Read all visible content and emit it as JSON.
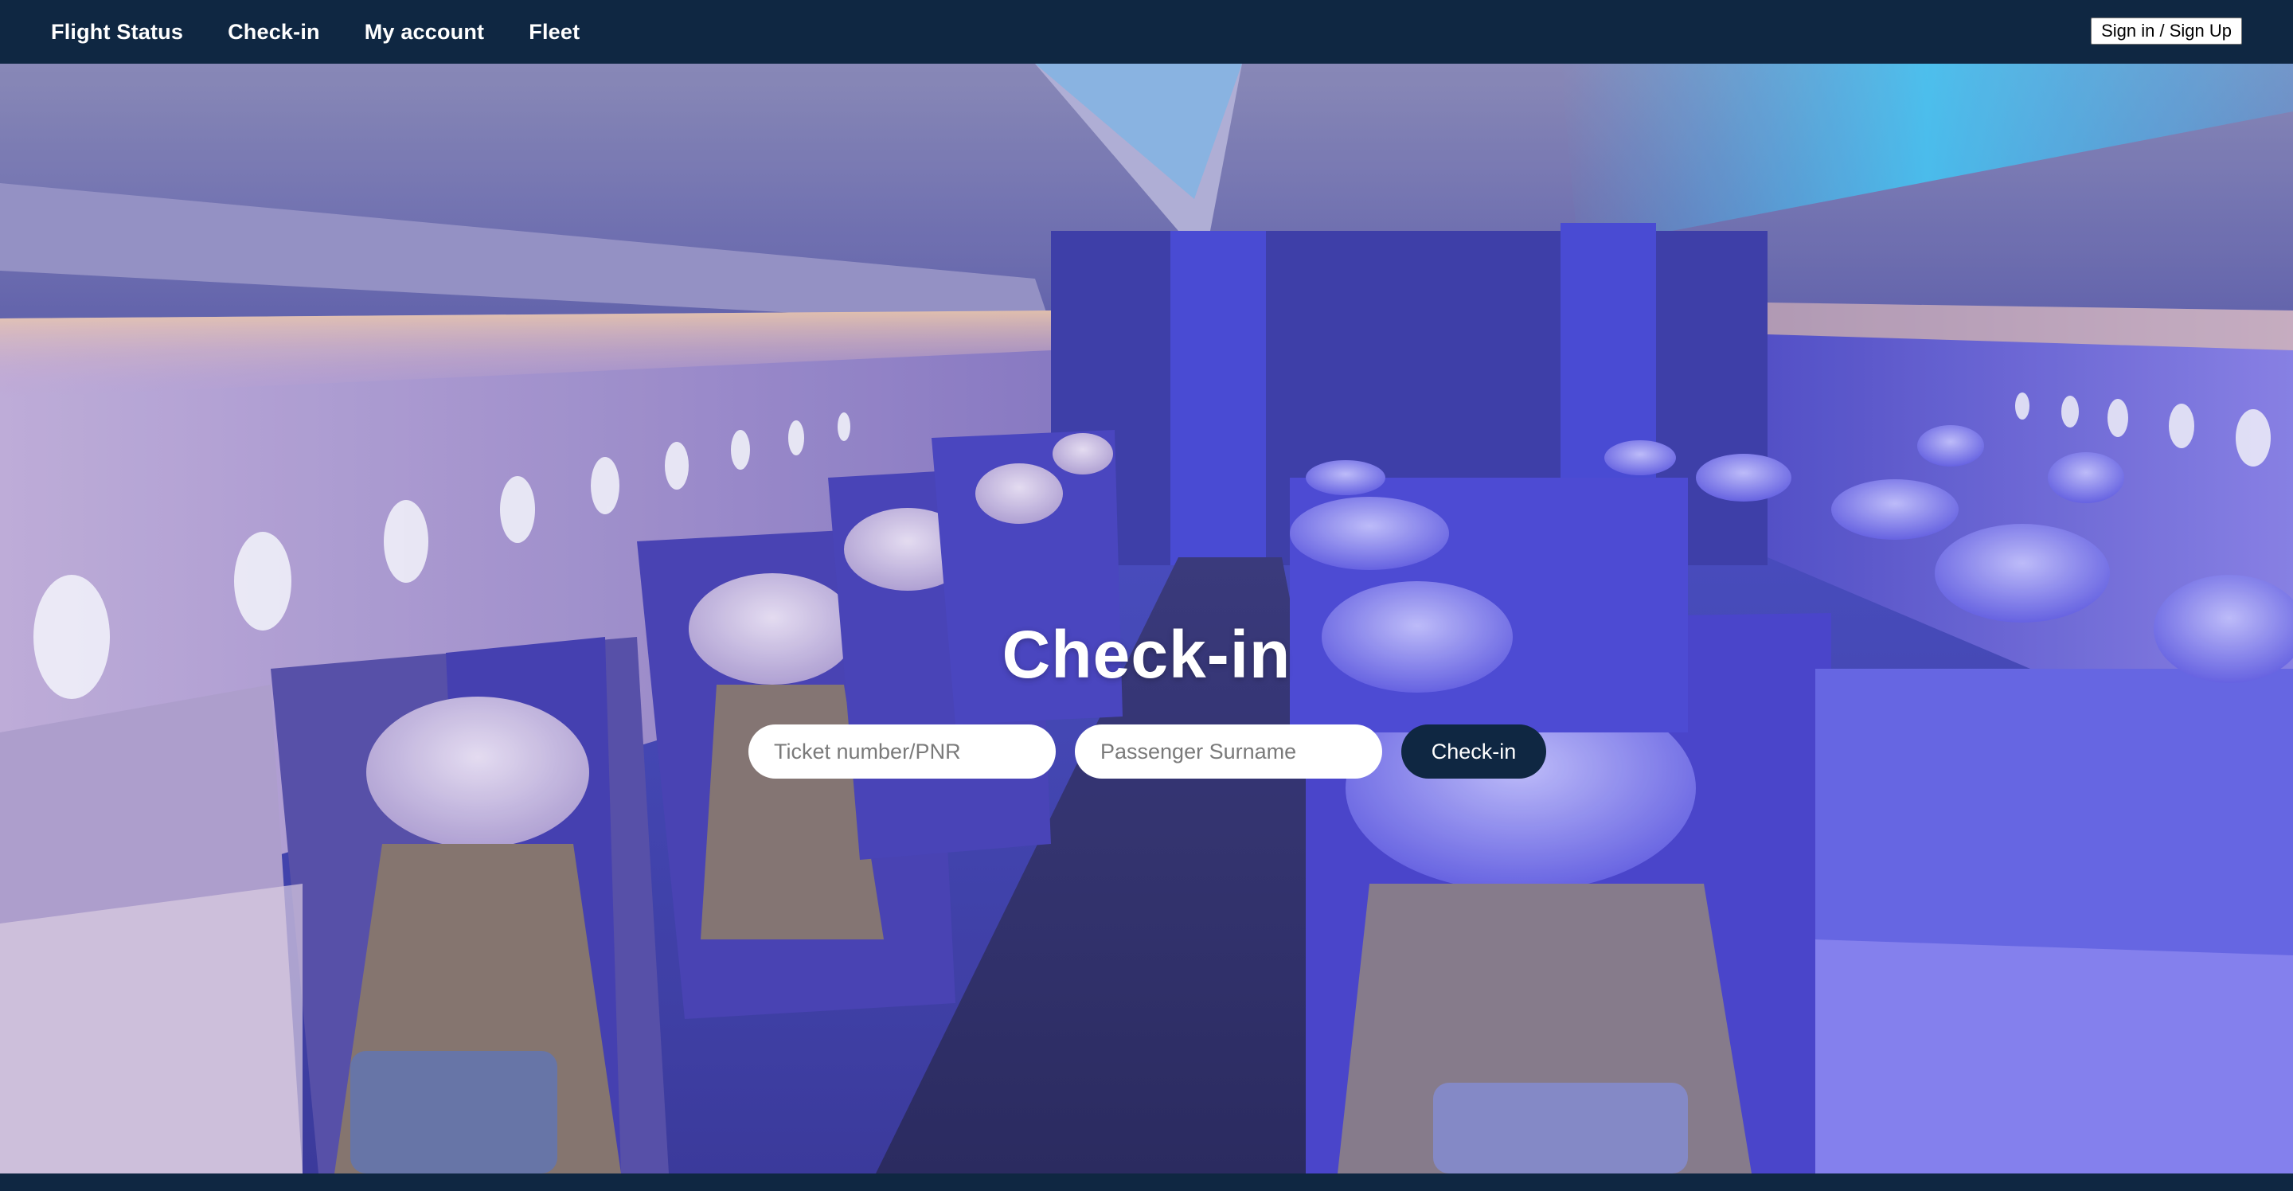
{
  "nav": {
    "links": [
      {
        "label": "Flight Status"
      },
      {
        "label": "Check-in"
      },
      {
        "label": "My account"
      },
      {
        "label": "Fleet"
      }
    ],
    "signin_label": "Sign in / Sign Up"
  },
  "hero": {
    "image": "aircraft-cabin-interior"
  },
  "checkin": {
    "title": "Check-in",
    "ticket_placeholder": "Ticket number/PNR",
    "ticket_value": "",
    "surname_placeholder": "Passenger Surname",
    "surname_value": "",
    "submit_label": "Check-in"
  },
  "colors": {
    "navy": "#0f2742",
    "white": "#ffffff"
  }
}
